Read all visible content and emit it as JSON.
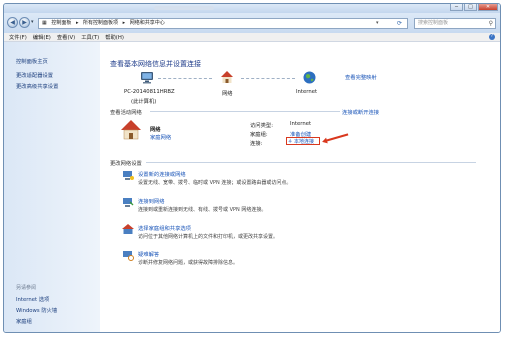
{
  "window": {
    "minimize_glyph": "─",
    "maximize_glyph": "□",
    "close_glyph": "✕"
  },
  "address": {
    "segments": [
      "控制面板",
      "▸",
      "所有控制面板项",
      "▸",
      "网络和共享中心"
    ],
    "dropdown_glyph": "▾",
    "search_placeholder": "搜索控制面板",
    "search_glyph": "⚲"
  },
  "nav": {
    "back": "◀",
    "forward": "▶",
    "recent": "▾"
  },
  "menu": {
    "items": [
      "文件(F)",
      "编辑(E)",
      "查看(V)",
      "工具(T)",
      "帮助(H)"
    ],
    "help_glyph": "?"
  },
  "sidebar": {
    "items": [
      "控制面板主页",
      "更改适配器设置",
      "更改高级共享设置"
    ],
    "see_also": "另请参阅",
    "see_also_items": [
      "Internet 选项",
      "Windows 防火墙",
      "家庭组"
    ]
  },
  "main": {
    "heading": "查看基本网络信息并设置连接",
    "see_full_map": "查看完整映射",
    "map": {
      "computer_name": "PC-20140811HRBZ",
      "computer_sub": "(此计算机)",
      "network": "网络",
      "internet": "Internet"
    },
    "active_networks_label": "查看活动网络",
    "connect_disconnect": "连接或断开连接",
    "network_name": "网络",
    "network_type": "家庭网络",
    "access_type_label": "访问类型:",
    "access_type_value": "Internet",
    "homegroup_label": "家庭组:",
    "homegroup_value": "准备创建",
    "connections_label": "连接:",
    "connection_value": "本地连接",
    "change_settings_label": "更改网络设置",
    "tasks": [
      {
        "title": "设置新的连接或网络",
        "desc": "设置无线、宽带、拨号、临时或 VPN 连接；或设置路由器或访问点。"
      },
      {
        "title": "连接到网络",
        "desc": "连接到或重新连接到无线、有线、拨号或 VPN 网络连接。"
      },
      {
        "title": "选择家庭组和共享选项",
        "desc": "访问位于其他网络计算机上的文件和打印机，或更改共享设置。"
      },
      {
        "title": "疑难解答",
        "desc": "诊断并修复网络问题，或获得故障排除信息。"
      }
    ]
  }
}
